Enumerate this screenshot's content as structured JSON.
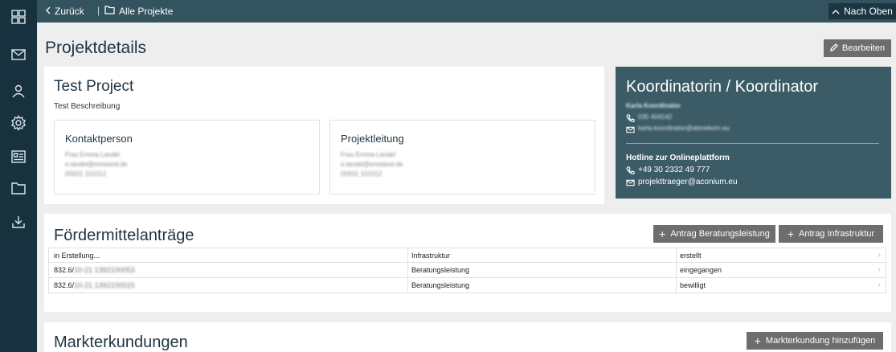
{
  "sidebar": {
    "icons": [
      "dashboard-icon",
      "mail-icon",
      "user-icon",
      "settings-icon",
      "id-card-icon",
      "folder-icon",
      "download-icon"
    ]
  },
  "topbar": {
    "back_label": "Zurück",
    "separator": "|",
    "projects_label": "Alle Projekte",
    "top_label": "Nach Oben"
  },
  "page": {
    "title": "Projektdetails",
    "edit_label": "Bearbeiten"
  },
  "project": {
    "name": "Test Project",
    "description": "Test Beschreibung",
    "contact": {
      "heading": "Kontaktperson",
      "lines": [
        "Frau Emma Landel",
        "e.landel@emsland.de",
        "05931 101012"
      ]
    },
    "lead": {
      "heading": "Projektleitung",
      "lines": [
        "Frau Emma Landel",
        "e.landel@emsland.de",
        "05931 101012"
      ]
    }
  },
  "coordinator": {
    "title": "Koordinatorin / Koordinator",
    "name": "Karla Koordinator",
    "phone": "030 404142",
    "email": "karla.koordinator@atenekom.eu",
    "hotline_title": "Hotline zur Onlineplattform",
    "hotline_phone": "+49 30 2332 49 777",
    "hotline_email": "projekttraeger@aconium.eu"
  },
  "antraege": {
    "title": "Fördermittelanträge",
    "btn_beratung": "Antrag Beratungsleistung",
    "btn_infra": "Antrag Infrastruktur",
    "rows": [
      {
        "id_prefix": "in Erstellung...",
        "id_blur": "",
        "type": "Infrastruktur",
        "status": "erstellt"
      },
      {
        "id_prefix": "832.6/",
        "id_blur": "10-21 1392100053",
        "type": "Beratungsleistung",
        "status": "eingegangen"
      },
      {
        "id_prefix": "832.6/",
        "id_blur": "10-21 1392100015",
        "type": "Beratungsleistung",
        "status": "bewilligt"
      }
    ]
  },
  "markt": {
    "title": "Markterkundungen",
    "btn_add": "Markterkundung hinzufügen"
  }
}
